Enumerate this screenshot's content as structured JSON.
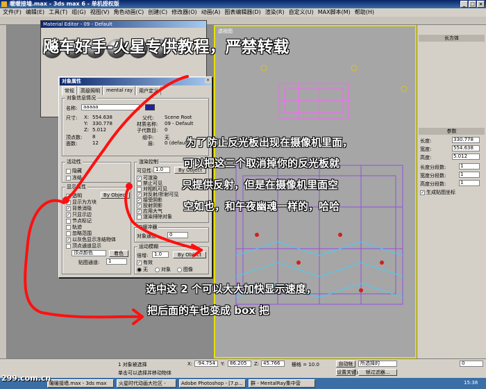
{
  "window": {
    "title": "暖暖接墙.max - 3ds max 6 - 单机授权版"
  },
  "menu": [
    "文件(F)",
    "编辑(E)",
    "工具(T)",
    "组(G)",
    "视图(V)",
    "角色动画(C)",
    "创建(C)",
    "修改器(O)",
    "动画(A)",
    "图表编辑器(D)",
    "渲染(R)",
    "自定义(U)",
    "MAX脚本(M)",
    "帮助(H)"
  ],
  "material_editor": {
    "title": "Material Editor - 09 - Default"
  },
  "viewport": {
    "label": "透视图"
  },
  "dialog": {
    "title": "对象属性",
    "tabs": [
      "常规",
      "高级照明",
      "mental ray",
      "用户定义"
    ],
    "info_group": "对象信息情况",
    "name_label": "名称:",
    "name_value": "aaaaa",
    "dim_label": "尺寸:",
    "x_label": "X:",
    "x_value": "554.638",
    "y_label": "Y:",
    "y_value": "330.778",
    "z_label": "Z:",
    "z_value": "5.012",
    "vertices_label": "顶点数:",
    "vertices_value": "8",
    "faces_label": "面数:",
    "faces_value": "12",
    "parent_label": "父代:",
    "parent_value": "Scene Root",
    "material_label": "材质名称:",
    "material_value": "09 - Default",
    "children_label": "子代数目:",
    "children_value": "0",
    "in_group_label": "组中:",
    "in_group_value": "无",
    "layer_label": "层:",
    "layer_value": "0 (default)",
    "interactivity_group": "活动性",
    "hide_label": "隐藏",
    "freeze_label": "冻结",
    "display_group": "显示属性",
    "display_items": [
      {
        "label": "透明",
        "checked": true
      },
      {
        "label": "显示为方块",
        "checked": true
      },
      {
        "label": "背景消隐",
        "checked": true
      },
      {
        "label": "只显示边",
        "checked": true
      },
      {
        "label": "节点标记",
        "checked": false
      },
      {
        "label": "轨迹",
        "checked": false
      },
      {
        "label": "忽略范围",
        "checked": false
      },
      {
        "label": "以灰色显示冻结物体",
        "checked": true
      },
      {
        "label": "顶点通道显示",
        "checked": false
      }
    ],
    "by_object": "By Object",
    "vertex_color_value": "顶点颜色",
    "shading_button": "着色",
    "map_channel_label": "贴图通道:",
    "map_channel_value": "1",
    "render_group": "渲染控制",
    "visibility_label": "可见性:",
    "visibility_value": "1.0",
    "render_items": [
      {
        "label": "可渲染",
        "checked": true
      },
      {
        "label": "禁止可见",
        "checked": false
      },
      {
        "label": "对相机可见",
        "checked": false
      },
      {
        "label": "对反射/折射可见",
        "checked": true
      },
      {
        "label": "接受阴影",
        "checked": true
      },
      {
        "label": "投射阴影",
        "checked": true
      },
      {
        "label": "应用大气",
        "checked": true
      },
      {
        "label": "渲染排除对象",
        "checked": false
      }
    ],
    "gbuffer_group": "G缓冲器",
    "object_channel_label": "对象通道:",
    "object_channel_value": "0",
    "motion_blur_group": "运动模糊",
    "multiplier_label": "倍增:",
    "multiplier_value": "1.0",
    "enabled_label": "有效",
    "blur_options": [
      {
        "label": "无",
        "checked": true
      },
      {
        "label": "对象",
        "checked": false
      },
      {
        "label": "图像",
        "checked": false
      }
    ]
  },
  "overlays": {
    "top_banner": "飚车好手-火星专供教程，严禁转载",
    "explain_lines": [
      "为了防止反光板出现在摄像机里面，",
      "可以把这三个取消掉你的反光板就",
      "只提供反射，但是在摄像机里面空",
      "空如也，和午夜幽魂一样的，哈哈"
    ],
    "bottom_lines": [
      "选中这 2 个可以大大加快显示速度，",
      "把后面的车也变成 box 把"
    ]
  },
  "right_panel": {
    "object_name": "长方体",
    "params_header": "参数",
    "length_label": "长度:",
    "length_value": "330.778",
    "width_label": "宽度:",
    "width_value": "554.638",
    "height_label": "高度:",
    "height_value": "5.012",
    "len_seg_label": "长度分段数:",
    "len_seg_value": "1",
    "wid_seg_label": "宽度分段数:",
    "wid_seg_value": "1",
    "hei_seg_label": "高度分段数:",
    "hei_seg_value": "1",
    "gen_map_label": "生成贴图坐标"
  },
  "status_bar": {
    "selected": "1 对象被选择",
    "hint": "单击可以选择并移动物体",
    "x_label": "X:",
    "x_value": "-94.754",
    "y_label": "Y:",
    "y_value": "86.205",
    "z_label": "Z:",
    "z_value": "45.766",
    "grid_label": "栅格 = 10.0",
    "autokey": "自动帐",
    "set_key": "设置关键点",
    "selection_set": "所选择的",
    "key_filter": "帧过滤器...",
    "frame": "0"
  },
  "taskbar": {
    "items": [
      "暖暖接墙.max - 3ds max",
      "火星时代动画大社区 -",
      "Adobe Photoshop - [7.p...",
      "群 - MentalRay集中营"
    ],
    "clock": "15:38"
  },
  "watermark": "299.com.cn"
}
